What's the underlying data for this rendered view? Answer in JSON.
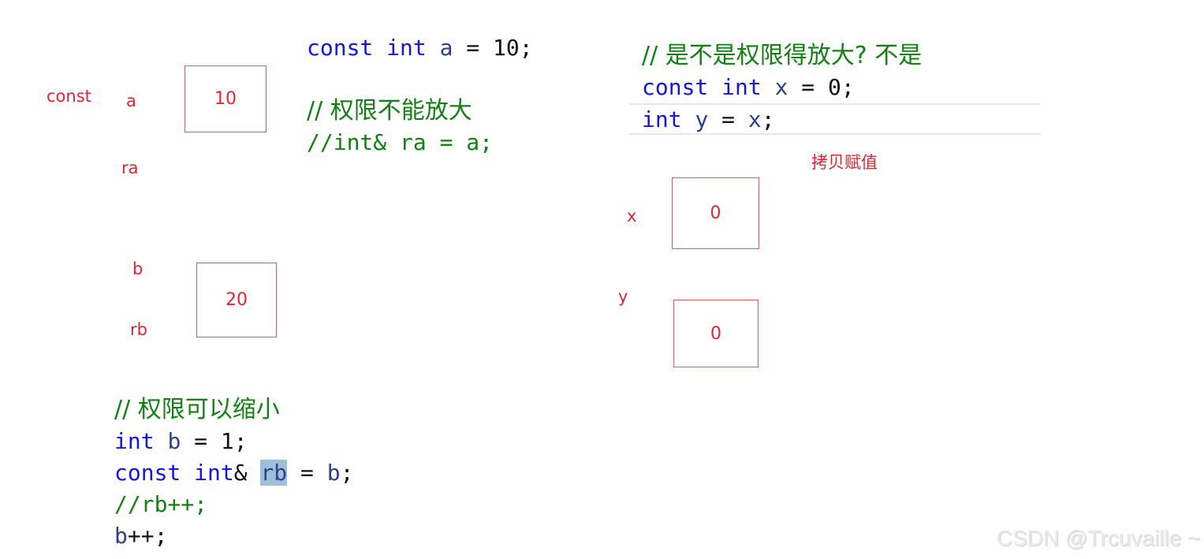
{
  "left_diagram": {
    "const_label": "const",
    "a_label": "a",
    "a_value": "10",
    "ra_label": "ra",
    "b_label": "b",
    "b_value": "20",
    "rb_label": "rb"
  },
  "code_top_left": {
    "line1": {
      "kw1": "const",
      "kw2": "int",
      "id": "a",
      "rest": " = 10;"
    },
    "comment": "// 权限不能放大",
    "comment_code": "//int& ra = a;"
  },
  "code_top_right": {
    "comment": "// 是不是权限得放大? 不是",
    "line1": {
      "kw1": "const",
      "kw2": "int",
      "id": "x",
      "rest": " = 0;"
    },
    "line2": {
      "kw": "int",
      "id1": "y",
      "eq": " = ",
      "id2": "x",
      "end": ";"
    }
  },
  "right_diagram": {
    "caption": "拷贝赋值",
    "x_label": "x",
    "x_value": "0",
    "y_label": "y",
    "y_value": "0"
  },
  "code_bottom": {
    "comment": "// 权限可以缩小",
    "line1": {
      "kw": "int",
      "id": "b",
      "rest": " = 1;"
    },
    "line2": {
      "kw1": "const",
      "kw2": "int",
      "amp": "& ",
      "sel": "rb",
      "eq": " = ",
      "id": "b",
      "end": ";"
    },
    "line3": "//rb++;",
    "line4": {
      "id": "b",
      "rest": "++;"
    }
  },
  "watermark": "CSDN @Trcuvaille ~"
}
